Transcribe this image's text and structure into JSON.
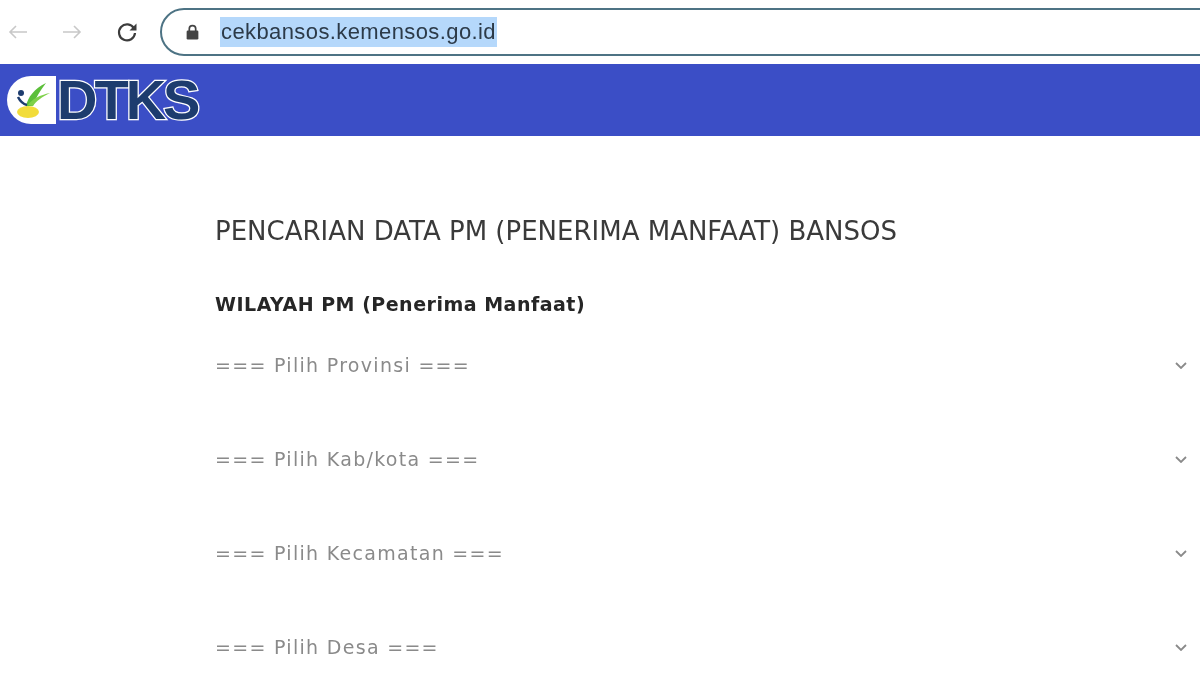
{
  "browser": {
    "nav": [
      {
        "kind": "back",
        "disabled": true
      },
      {
        "kind": "forward",
        "disabled": true
      },
      {
        "kind": "reload",
        "disabled": false
      }
    ],
    "address_bar": {
      "url": "cekbansos.kemensos.go.id",
      "selected": true
    }
  },
  "header": {
    "logo_text": "DTKS"
  },
  "form": {
    "title": "PENCARIAN DATA PM (PENERIMA MANFAAT) BANSOS",
    "section_label": "WILAYAH PM (Penerima Manfaat)",
    "dropdowns": [
      {
        "value": "=== Pilih Provinsi ==="
      },
      {
        "value": "=== Pilih Kab/kota ==="
      },
      {
        "value": "=== Pilih Kecamatan ==="
      },
      {
        "value": "=== Pilih Desa ==="
      }
    ]
  }
}
